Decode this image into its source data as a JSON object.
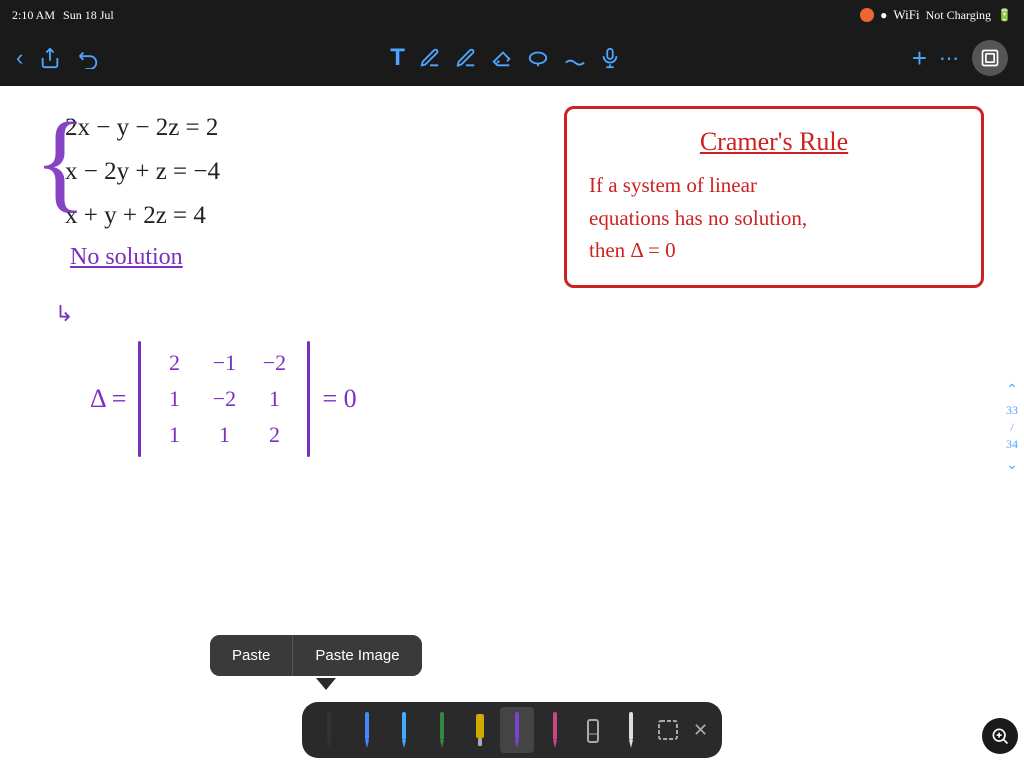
{
  "statusBar": {
    "time": "2:10 AM",
    "day": "Sun 18 Jul",
    "recordIcon": "●",
    "wifiIcon": "wifi",
    "batteryText": "Not Charging",
    "batteryIcon": "🔋"
  },
  "toolbar": {
    "backLabel": "‹",
    "shareLabel": "⬆",
    "undoLabel": "↩",
    "textLabel": "T",
    "penLabel": "✏",
    "eraserLabel": "◇",
    "lassoLabel": "◯",
    "markerLabel": "✒",
    "micLabel": "🎤",
    "addLabel": "+",
    "moreLabel": "⋯",
    "layersLabel": "⧉"
  },
  "equations": {
    "eq1": "2x − y − 2z = 2",
    "eq2": "x − 2y + z = −4",
    "eq3": "x + y + 2z = 4"
  },
  "noSolution": {
    "label": "No  solution"
  },
  "delta": {
    "label": "Δ =",
    "matrix": [
      [
        "2",
        "−1",
        "−2"
      ],
      [
        "1",
        "−2",
        "1"
      ],
      [
        "1",
        "1",
        "2"
      ]
    ],
    "equalsZero": "= 0"
  },
  "cramersRule": {
    "title": "Cramer's Rule",
    "text1": "If  a  system  of  linear",
    "text2": "equations  has  no  solution,",
    "text3": "then    Δ = 0"
  },
  "pasteMenu": {
    "pasteLabel": "Paste",
    "pasteImageLabel": "Paste Image"
  },
  "bottomToolbar": {
    "tools": [
      {
        "name": "pen-black",
        "color": "#222"
      },
      {
        "name": "pen-blue",
        "color": "#4488ff"
      },
      {
        "name": "pen-blue2",
        "color": "#44aaff"
      },
      {
        "name": "pen-teal",
        "color": "#338844"
      },
      {
        "name": "marker-yellow",
        "color": "#ccaa00"
      },
      {
        "name": "pen-purple",
        "color": "#7744cc"
      },
      {
        "name": "pen-pink",
        "color": "#cc4488"
      },
      {
        "name": "eraser",
        "color": "#aaa"
      },
      {
        "name": "pencil-light",
        "color": "#ddd"
      },
      {
        "name": "selector",
        "color": "#888"
      }
    ],
    "closeLabel": "✕"
  },
  "pagination": {
    "upArrow": "⌃",
    "downArrow": "⌄",
    "current": "33",
    "separator": "/",
    "total": "34"
  },
  "zoomBtn": {
    "label": "⊕"
  }
}
